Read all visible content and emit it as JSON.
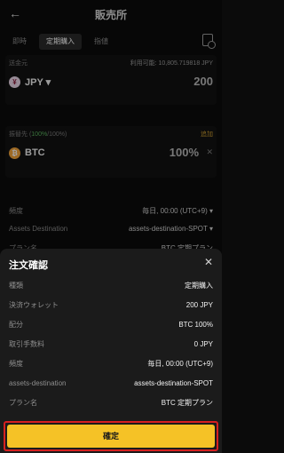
{
  "header": {
    "title": "販売所",
    "back_glyph": "←"
  },
  "tabs": [
    {
      "label": "即時",
      "active": false
    },
    {
      "label": "定期購入",
      "active": true
    },
    {
      "label": "指値",
      "active": false
    }
  ],
  "from_panel": {
    "label": "送金元",
    "available": "利用可能: 10,805.719818 JPY",
    "currency": "JPY ▾",
    "amount": "200"
  },
  "to_panel": {
    "label_prefix": "振替先 (",
    "label_pct": "100%",
    "label_suffix": "/100%)",
    "add_label": "追加",
    "currency": "BTC",
    "percent": "100%",
    "remove_glyph": "✕"
  },
  "background_rows": [
    {
      "key": "頻度",
      "value": "毎日, 00:00 (UTC+9) ▾"
    },
    {
      "key": "Assets Destination",
      "value": "assets-destination-SPOT ▾"
    },
    {
      "key": "プラン名",
      "value": "BTC 定期プラン"
    }
  ],
  "sheet": {
    "title": "注文確認",
    "close_glyph": "✕",
    "rows": [
      {
        "key": "種類",
        "value": "定期購入"
      },
      {
        "key": "決済ウォレット",
        "value": "200 JPY"
      },
      {
        "key": "配分",
        "value": "BTC 100%"
      },
      {
        "key": "取引手数料",
        "value": "0 JPY"
      },
      {
        "key": "頻度",
        "value": "毎日, 00:00 (UTC+9)"
      },
      {
        "key": "assets-destination",
        "value": "assets-destination-SPOT"
      },
      {
        "key": "プラン名",
        "value": "BTC 定期プラン"
      }
    ],
    "confirm_label": "確定"
  },
  "colors": {
    "accent": "#f5c226",
    "highlight": "#d62020",
    "positive": "#58b05c",
    "link": "#c99a2e"
  }
}
